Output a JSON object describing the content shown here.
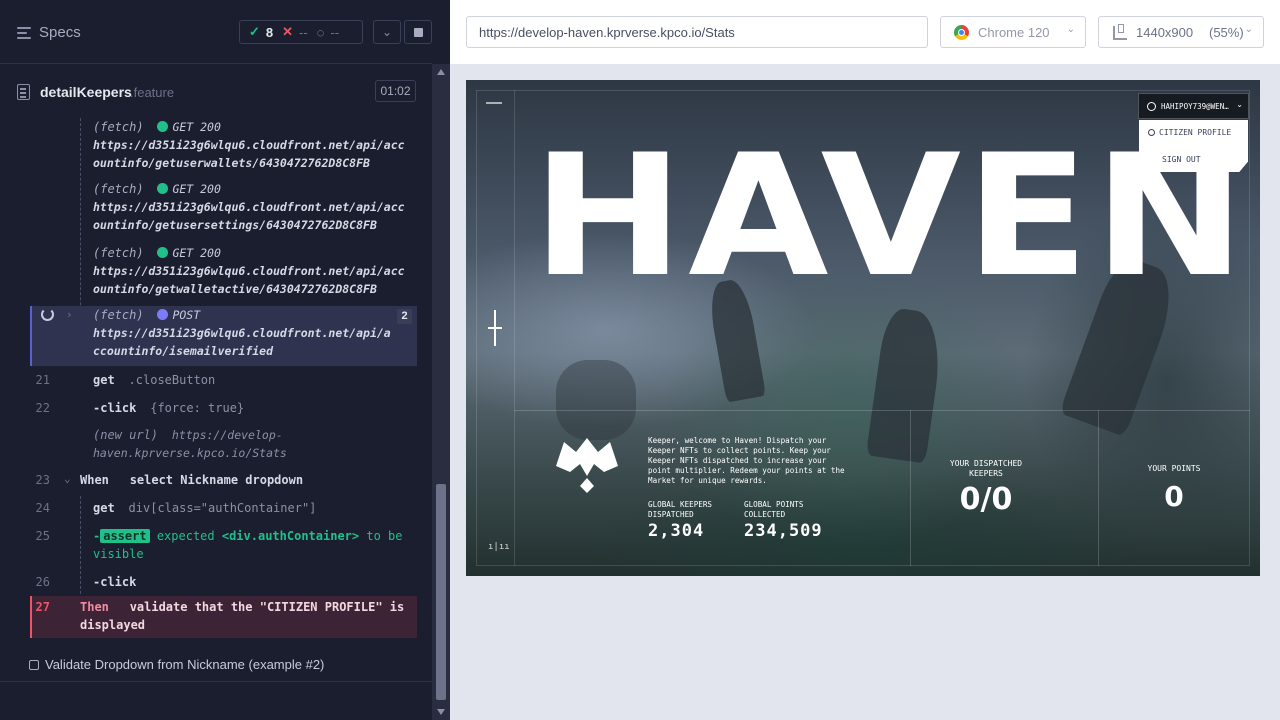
{
  "header": {
    "specs_label": "Specs",
    "passed_count": "8",
    "failed_count": "--",
    "pending_count": "--"
  },
  "spec": {
    "name": "detailKeepers",
    "extension": ".feature",
    "duration": "01:02"
  },
  "commands": [
    {
      "name": "(fetch)",
      "method": "GET 200",
      "url_line1": "https://d351i23g6wlqu6.cloudfront.net/api/acc",
      "url_line2": "ountinfo/getuserwallets/6430472762D8C8FB"
    },
    {
      "name": "(fetch)",
      "method": "GET 200",
      "url_line1": "https://d351i23g6wlqu6.cloudfront.net/api/acc",
      "url_line2": "ountinfo/getusersettings/6430472762D8C8FB"
    },
    {
      "name": "(fetch)",
      "method": "GET 200",
      "url_line1": "https://d351i23g6wlqu6.cloudfront.net/api/acc",
      "url_line2": "ountinfo/getwalletactive/6430472762D8C8FB"
    },
    {
      "name": "(fetch)",
      "method": "POST",
      "url_line1": "https://d351i23g6wlqu6.cloudfront.net/api/a",
      "url_line2": "ccountinfo/isemailverified",
      "count": "2"
    }
  ],
  "steps": {
    "s21": {
      "num": "21",
      "cmd": "get",
      "arg": ".closeButton"
    },
    "s22": {
      "num": "22",
      "cmd": "-click",
      "arg": "{force: true}"
    },
    "newurl": {
      "label": "(new url)",
      "url_line1": "https://develop-",
      "url_line2": "haven.kprverse.kpco.io/Stats"
    },
    "s23": {
      "num": "23",
      "kw": "When",
      "text": "select Nickname dropdown"
    },
    "s24": {
      "num": "24",
      "cmd": "get",
      "arg": "div[class=\"authContainer\"]"
    },
    "s25": {
      "num": "25",
      "prefix": "-",
      "tag": "assert",
      "text1": "expected",
      "el": "<div.authContainer>",
      "text2": "to be",
      "text3": "visible"
    },
    "s26": {
      "num": "26",
      "cmd": "-click"
    },
    "s27": {
      "num": "27",
      "kw": "Then",
      "line1": "validate that the \"CITIZEN PROFILE\" is",
      "line2": "displayed"
    }
  },
  "example2_label": "Validate Dropdown from Nickname (example #2)",
  "url_bar": {
    "url": "https://develop-haven.kprverse.kpco.io/Stats",
    "browser": "Chrome 120",
    "viewport": "1440x900",
    "zoom": "(55%)"
  },
  "aut": {
    "title": "HAVEN",
    "user_email": "HAHIPOY739@WEN…",
    "menu": [
      "CITIZEN PROFILE",
      "SIGN OUT"
    ],
    "welcome_text": "Keeper, welcome to Haven! Dispatch your Keeper NFTs to collect points. Keep your Keeper NFTs dispatched to increase your point multiplier. Redeem your points at the Market for unique rewards.",
    "global_keepers_label_1": "GLOBAL KEEPERS",
    "global_keepers_label_2": "DISPATCHED",
    "global_keepers_value": "2,304",
    "global_points_label_1": "GLOBAL POINTS",
    "global_points_label_2": "COLLECTED",
    "global_points_value": "234,509",
    "dispatched_label_1": "YOUR DISPATCHED",
    "dispatched_label_2": "KEEPERS",
    "dispatched_value": "0/0",
    "points_label": "YOUR POINTS",
    "points_value": "0"
  },
  "colors": {
    "reporter_bg": "#1b1e2e",
    "pass": "#1fc08a",
    "fail": "#ef5364",
    "pending": "#7c7cf8"
  }
}
